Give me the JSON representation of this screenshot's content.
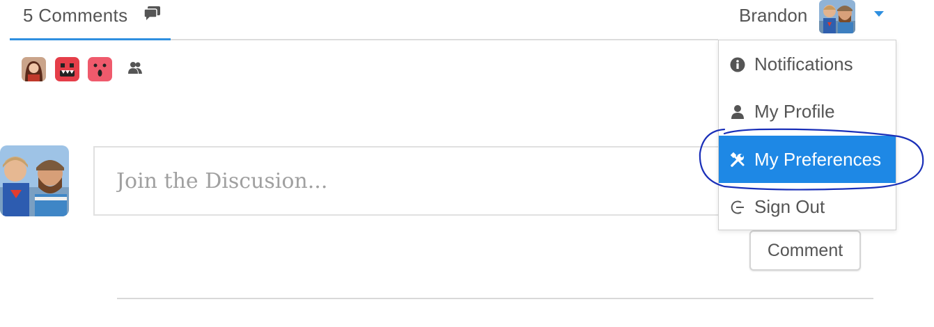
{
  "header": {
    "comments_tab_label": "5 Comments",
    "comments_icon": "comment-bubbles-icon",
    "username": "Brandon",
    "accent_color": "#2e8fe0"
  },
  "participants": {
    "avatars": [
      "participant-avatar-woman",
      "participant-avatar-red-monster",
      "participant-avatar-pink-monster"
    ],
    "more_icon": "people-icon"
  },
  "composer": {
    "placeholder": "Join the Discusion...",
    "submit_label": "Comment"
  },
  "user_menu": {
    "active_color": "#1e88e5",
    "items": [
      {
        "label": "Notifications",
        "icon": "info-circle-icon"
      },
      {
        "label": "My Profile",
        "icon": "user-icon"
      },
      {
        "label": "My Preferences",
        "icon": "tools-icon",
        "active": true
      },
      {
        "label": "Sign Out",
        "icon": "sign-out-icon"
      }
    ]
  },
  "annotation": {
    "color": "#1a2fb8",
    "shape": "hand-drawn ellipse around My Preferences"
  }
}
